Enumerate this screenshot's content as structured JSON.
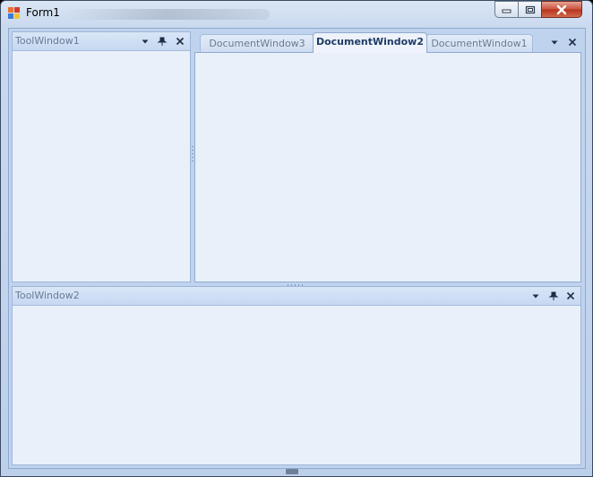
{
  "window": {
    "title": "Form1"
  },
  "tool_windows": [
    {
      "title": "ToolWindow1"
    },
    {
      "title": "ToolWindow2"
    }
  ],
  "document_tabs": [
    {
      "label": "DocumentWindow3",
      "active": false
    },
    {
      "label": "DocumentWindow2",
      "active": true
    },
    {
      "label": "DocumentWindow1",
      "active": false
    }
  ],
  "glyphs": {
    "dropdown": "▾",
    "pin": "📌",
    "close": "✕",
    "minimize": "–",
    "maximize": "▢",
    "window_close": "✕"
  },
  "colors": {
    "active_tab_text": "#1f3b66",
    "inactive_text": "#6b7b93",
    "pane_background": "#e9f0fa",
    "close_button": "#c8513e"
  }
}
